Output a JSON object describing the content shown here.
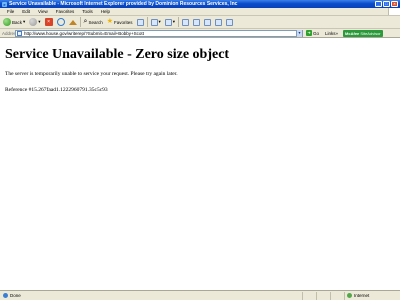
{
  "window": {
    "title": "Service Unavailable - Microsoft Internet Explorer provided by Dominion Resources Services, Inc",
    "buttons": {
      "minimize": "_",
      "maximize": "□",
      "close": "×"
    }
  },
  "menu": {
    "items": [
      "File",
      "Edit",
      "View",
      "Favorites",
      "Tools",
      "Help"
    ]
  },
  "toolbar": {
    "back_label": "Back",
    "search_label": "Search",
    "favorites_label": "Favorites"
  },
  "address": {
    "label": "Address",
    "url": "http://www.house.gov/writerep/?Submit=Email+Bobby+Scott",
    "go_label": "Go",
    "links_label": "Links",
    "mcafee_brand": "McAfee",
    "mcafee_suffix": "SiteAdvisor"
  },
  "page": {
    "heading": "Service Unavailable - Zero size object",
    "message": "The server is temporarily unable to service your request. Please try again later.",
    "reference": "Reference #15.267faad1.1222960791.35c5c93"
  },
  "status": {
    "text": "Done",
    "zone": "Internet"
  },
  "colors": {
    "titlebar": "#0a4ccc",
    "chrome": "#ece9d8",
    "mcafee": "#2a9a3a"
  }
}
